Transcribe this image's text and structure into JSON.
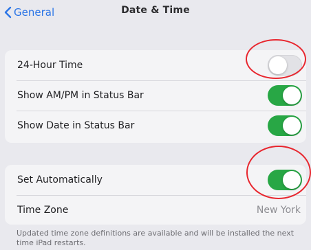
{
  "nav": {
    "back_label": "General",
    "title": "Date & Time"
  },
  "settings_group_1": [
    {
      "label": "24-Hour Time",
      "toggle": "off"
    },
    {
      "label": "Show AM/PM in Status Bar",
      "toggle": "on"
    },
    {
      "label": "Show Date in Status Bar",
      "toggle": "on"
    }
  ],
  "settings_group_2": [
    {
      "label": "Set Automatically",
      "toggle": "on"
    },
    {
      "label": "Time Zone",
      "value": "New York"
    }
  ],
  "footnote": "Updated time zone definitions are available and will be installed the next time iPad restarts.",
  "colors": {
    "accent_blue": "#2a74e6",
    "toggle_on": "#28a745",
    "toggle_off": "#e2e2e6",
    "annotation_red": "#e8262e"
  },
  "icons": {
    "back": "chevron-left-icon"
  }
}
